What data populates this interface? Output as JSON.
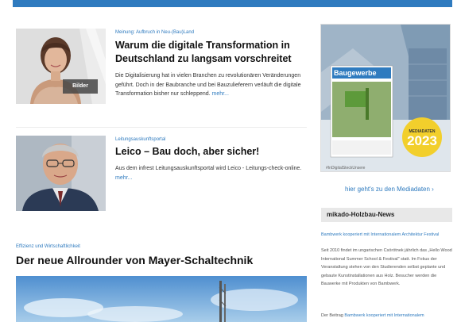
{
  "articles": [
    {
      "kicker": "Meinung: Aufbruch in Neu-(Bau)Land",
      "title_line1": "Warum die digitale Transformation in",
      "title_line2": "Deutschland zu langsam vorschreitet",
      "teaser": "Die Digitalisierung hat in vielen Branchen zu revolutionären Veränderungen geführt. Doch in der Baubranche und bei Bauzulieferern verläuft die digitale Transformation bisher nur schleppend.",
      "more": "mehr...",
      "badge": "Bilder"
    },
    {
      "kicker": "Leitungsauskunftsportal",
      "title": "Leico – Bau doch, aber sicher!",
      "teaser": "Aus dem infrest Leitungsauskunftsportal wird Leico - Leitungs-check-online.",
      "more": "mehr..."
    },
    {
      "kicker": "Effizienz und Wirtschaftlichkeit",
      "title": "Der neue Allrounder von Mayer-Schaltechnik"
    }
  ],
  "sidebar": {
    "ad": {
      "magazine_title": "Baugewerbe",
      "badge_label": "MEDIADATEN",
      "badge_year": "2023",
      "footer": "#InDigitalSteckUnsere"
    },
    "mediadaten_link": "hier geht's zu den Mediadaten",
    "mediadaten_arrow": "›",
    "news_heading": "mikado-Holzbau-News",
    "news_item_title": "Bambwerk kooperiert mit Internationalem Architektur Festival",
    "news_item_text": "Seit 2010 findet im ungarischen Csörötnek jährlich das „Hello Wood International Summer School & Festival\" statt. Im Fokus der Veranstaltung stehen von den Studierenden selbst geplante und gebaute Kunstinstallationen aus Holz. Besucher werden die Bauwerke mit Produkten von Bambwerk.",
    "news_item_more_prefix": "Der Beitrag",
    "news_item_more_link": "Bambwerk kooperiert mit Internationalem"
  },
  "colors": {
    "accent": "#2f7bbf",
    "badge_yellow": "#f2cf2c"
  }
}
